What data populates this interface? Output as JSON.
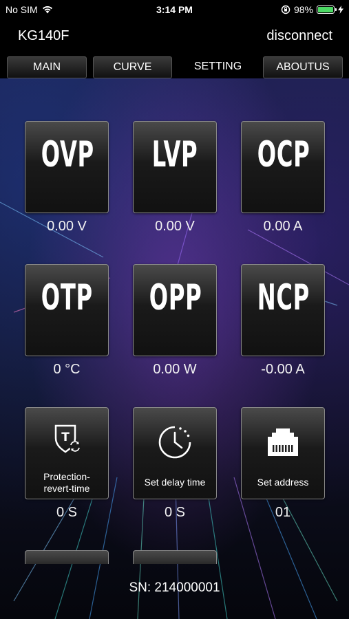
{
  "status_bar": {
    "carrier": "No SIM",
    "time": "3:14 PM",
    "battery": "98%",
    "battery_level": 0.98
  },
  "header": {
    "title": "KG140F",
    "disconnect_label": "disconnect"
  },
  "tabs": [
    {
      "label": "MAIN"
    },
    {
      "label": "CURVE"
    },
    {
      "label": "SETTING"
    },
    {
      "label": "ABOUTUS"
    }
  ],
  "active_tab": "SETTING",
  "settings": [
    {
      "label": "OVP",
      "value": "0.00 V"
    },
    {
      "label": "LVP",
      "value": "0.00 V"
    },
    {
      "label": "OCP",
      "value": "0.00 A"
    },
    {
      "label": "OTP",
      "value": "0 °C"
    },
    {
      "label": "OPP",
      "value": "0.00 W"
    },
    {
      "label": "NCP",
      "value": "-0.00 A"
    },
    {
      "label": "Protection-revert-time",
      "value": "0 S",
      "icon": "protection-revert-icon"
    },
    {
      "label": "Set delay time",
      "value": "0 S",
      "icon": "clock-icon"
    },
    {
      "label": "Set address",
      "value": "01",
      "icon": "ethernet-port-icon"
    }
  ],
  "footer": {
    "sn": "SN: 214000001"
  },
  "colors": {
    "battery_fill": "#4cd964",
    "background_purple": "#3a2a6a"
  }
}
